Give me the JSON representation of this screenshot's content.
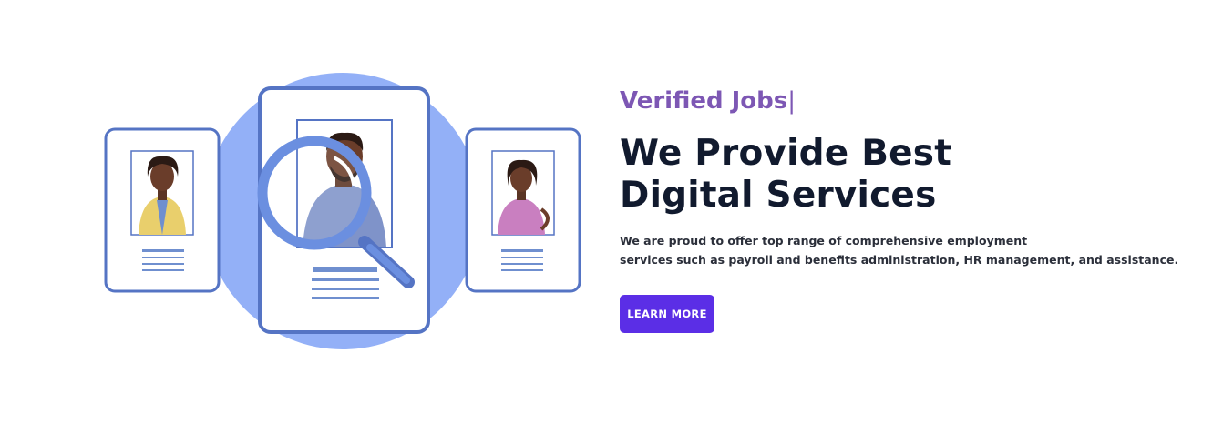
{
  "hero": {
    "eyebrow": "Verified Jobs",
    "eyebrow_cursor": "|",
    "headline_line1": "We Provide Best",
    "headline_line2": "Digital Services",
    "description_line1": "We are proud to offer top range of comprehensive employment",
    "description_line2": "services such as payroll and benefits administration, HR management, and assistance.",
    "cta_label": "LEARN MORE"
  },
  "colors": {
    "eyebrow": "#7d57b4",
    "headline": "#111a2e",
    "cta_background": "#5b2ee6",
    "illustration_circle": "#93b0f7",
    "card_border": "#5574c4"
  },
  "illustration": {
    "icons": [
      "candidate-card-left",
      "candidate-card-center",
      "candidate-card-right",
      "magnifying-glass-icon"
    ]
  }
}
